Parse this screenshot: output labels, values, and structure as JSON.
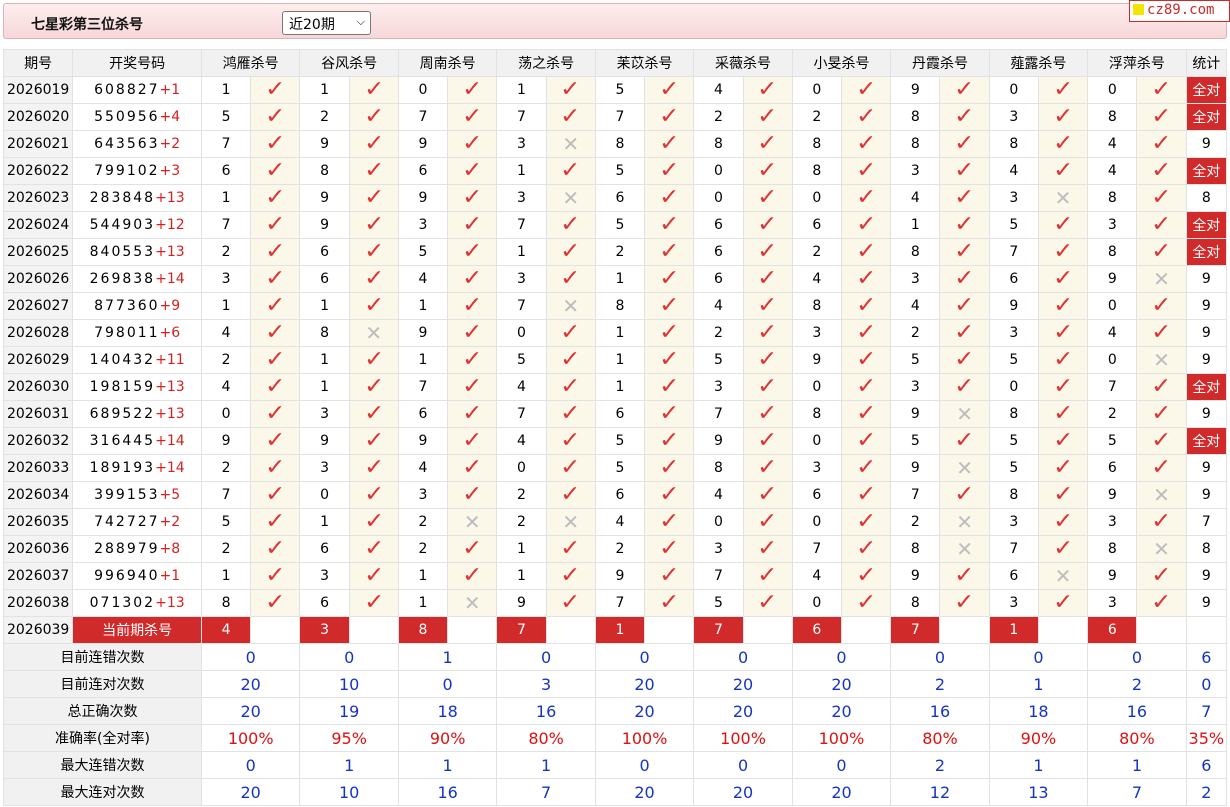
{
  "header": {
    "title": "七星彩第三位杀号",
    "period_select": "近20期",
    "site_badge": "cz89.com"
  },
  "table": {
    "columns": [
      "期号",
      "开奖号码",
      "鸿雁杀号",
      "谷风杀号",
      "周南杀号",
      "荡之杀号",
      "苿苡杀号",
      "采薇杀号",
      "小旻杀号",
      "丹霞杀号",
      "薤露杀号",
      "浮萍杀号",
      "统计"
    ],
    "rows": [
      {
        "issue": "2026019",
        "nums": "608827",
        "plus": "+1",
        "k": [
          "1",
          "1",
          "0",
          "1",
          "5",
          "4",
          "0",
          "9",
          "0",
          "0"
        ],
        "ok": [
          1,
          1,
          1,
          1,
          1,
          1,
          1,
          1,
          1,
          1
        ],
        "stat": "全对"
      },
      {
        "issue": "2026020",
        "nums": "550956",
        "plus": "+4",
        "k": [
          "5",
          "2",
          "7",
          "7",
          "7",
          "2",
          "2",
          "8",
          "3",
          "8"
        ],
        "ok": [
          1,
          1,
          1,
          1,
          1,
          1,
          1,
          1,
          1,
          1
        ],
        "stat": "全对"
      },
      {
        "issue": "2026021",
        "nums": "643563",
        "plus": "+2",
        "k": [
          "7",
          "9",
          "9",
          "3",
          "8",
          "8",
          "8",
          "8",
          "8",
          "4"
        ],
        "ok": [
          1,
          1,
          1,
          0,
          1,
          1,
          1,
          1,
          1,
          1
        ],
        "stat": "9"
      },
      {
        "issue": "2026022",
        "nums": "799102",
        "plus": "+3",
        "k": [
          "6",
          "8",
          "6",
          "1",
          "5",
          "0",
          "8",
          "3",
          "4",
          "4"
        ],
        "ok": [
          1,
          1,
          1,
          1,
          1,
          1,
          1,
          1,
          1,
          1
        ],
        "stat": "全对"
      },
      {
        "issue": "2026023",
        "nums": "283848",
        "plus": "+13",
        "k": [
          "1",
          "9",
          "9",
          "3",
          "6",
          "0",
          "0",
          "4",
          "3",
          "8"
        ],
        "ok": [
          1,
          1,
          1,
          0,
          1,
          1,
          1,
          1,
          0,
          1
        ],
        "stat": "8"
      },
      {
        "issue": "2026024",
        "nums": "544903",
        "plus": "+12",
        "k": [
          "7",
          "9",
          "3",
          "7",
          "5",
          "6",
          "6",
          "1",
          "5",
          "3"
        ],
        "ok": [
          1,
          1,
          1,
          1,
          1,
          1,
          1,
          1,
          1,
          1
        ],
        "stat": "全对"
      },
      {
        "issue": "2026025",
        "nums": "840553",
        "plus": "+13",
        "k": [
          "2",
          "6",
          "5",
          "1",
          "2",
          "6",
          "2",
          "8",
          "7",
          "8"
        ],
        "ok": [
          1,
          1,
          1,
          1,
          1,
          1,
          1,
          1,
          1,
          1
        ],
        "stat": "全对"
      },
      {
        "issue": "2026026",
        "nums": "269838",
        "plus": "+14",
        "k": [
          "3",
          "6",
          "4",
          "3",
          "1",
          "6",
          "4",
          "3",
          "6",
          "9"
        ],
        "ok": [
          1,
          1,
          1,
          1,
          1,
          1,
          1,
          1,
          1,
          0
        ],
        "stat": "9"
      },
      {
        "issue": "2026027",
        "nums": "877360",
        "plus": "+9",
        "k": [
          "1",
          "1",
          "1",
          "7",
          "8",
          "4",
          "8",
          "4",
          "9",
          "0"
        ],
        "ok": [
          1,
          1,
          1,
          0,
          1,
          1,
          1,
          1,
          1,
          1
        ],
        "stat": "9"
      },
      {
        "issue": "2026028",
        "nums": "798011",
        "plus": "+6",
        "k": [
          "4",
          "8",
          "9",
          "0",
          "1",
          "2",
          "3",
          "2",
          "3",
          "4"
        ],
        "ok": [
          1,
          0,
          1,
          1,
          1,
          1,
          1,
          1,
          1,
          1
        ],
        "stat": "9"
      },
      {
        "issue": "2026029",
        "nums": "140432",
        "plus": "+11",
        "k": [
          "2",
          "1",
          "1",
          "5",
          "1",
          "5",
          "9",
          "5",
          "5",
          "0"
        ],
        "ok": [
          1,
          1,
          1,
          1,
          1,
          1,
          1,
          1,
          1,
          0
        ],
        "stat": "9"
      },
      {
        "issue": "2026030",
        "nums": "198159",
        "plus": "+13",
        "k": [
          "4",
          "1",
          "7",
          "4",
          "1",
          "3",
          "0",
          "3",
          "0",
          "7"
        ],
        "ok": [
          1,
          1,
          1,
          1,
          1,
          1,
          1,
          1,
          1,
          1
        ],
        "stat": "全对"
      },
      {
        "issue": "2026031",
        "nums": "689522",
        "plus": "+13",
        "k": [
          "0",
          "3",
          "6",
          "7",
          "6",
          "7",
          "8",
          "9",
          "8",
          "2"
        ],
        "ok": [
          1,
          1,
          1,
          1,
          1,
          1,
          1,
          0,
          1,
          1
        ],
        "stat": "9"
      },
      {
        "issue": "2026032",
        "nums": "316445",
        "plus": "+14",
        "k": [
          "9",
          "9",
          "9",
          "4",
          "5",
          "9",
          "0",
          "5",
          "5",
          "5"
        ],
        "ok": [
          1,
          1,
          1,
          1,
          1,
          1,
          1,
          1,
          1,
          1
        ],
        "stat": "全对"
      },
      {
        "issue": "2026033",
        "nums": "189193",
        "plus": "+14",
        "k": [
          "2",
          "3",
          "4",
          "0",
          "5",
          "8",
          "3",
          "9",
          "5",
          "6"
        ],
        "ok": [
          1,
          1,
          1,
          1,
          1,
          1,
          1,
          0,
          1,
          1
        ],
        "stat": "9"
      },
      {
        "issue": "2026034",
        "nums": "399153",
        "plus": "+5",
        "k": [
          "7",
          "0",
          "3",
          "2",
          "6",
          "4",
          "6",
          "7",
          "8",
          "9"
        ],
        "ok": [
          1,
          1,
          1,
          1,
          1,
          1,
          1,
          1,
          1,
          0
        ],
        "stat": "9"
      },
      {
        "issue": "2026035",
        "nums": "742727",
        "plus": "+2",
        "k": [
          "5",
          "1",
          "2",
          "2",
          "4",
          "0",
          "0",
          "2",
          "3",
          "3"
        ],
        "ok": [
          1,
          1,
          0,
          0,
          1,
          1,
          1,
          0,
          1,
          1
        ],
        "stat": "7"
      },
      {
        "issue": "2026036",
        "nums": "288979",
        "plus": "+8",
        "k": [
          "2",
          "6",
          "2",
          "1",
          "2",
          "3",
          "7",
          "8",
          "7",
          "8"
        ],
        "ok": [
          1,
          1,
          1,
          1,
          1,
          1,
          1,
          0,
          1,
          0
        ],
        "stat": "8"
      },
      {
        "issue": "2026037",
        "nums": "996940",
        "plus": "+1",
        "k": [
          "1",
          "3",
          "1",
          "1",
          "9",
          "7",
          "4",
          "9",
          "6",
          "9"
        ],
        "ok": [
          1,
          1,
          1,
          1,
          1,
          1,
          1,
          1,
          0,
          1
        ],
        "stat": "9"
      },
      {
        "issue": "2026038",
        "nums": "071302",
        "plus": "+13",
        "k": [
          "8",
          "6",
          "1",
          "9",
          "7",
          "5",
          "0",
          "8",
          "3",
          "3"
        ],
        "ok": [
          1,
          1,
          0,
          1,
          1,
          1,
          1,
          1,
          1,
          1
        ],
        "stat": "9"
      }
    ],
    "current": {
      "issue": "2026039",
      "label": "当前期杀号",
      "k": [
        "4",
        "3",
        "8",
        "7",
        "1",
        "7",
        "6",
        "7",
        "1",
        "6"
      ]
    }
  },
  "summary": [
    {
      "label": "目前连错次数",
      "values": [
        "0",
        "0",
        "1",
        "0",
        "0",
        "0",
        "0",
        "0",
        "0",
        "0"
      ],
      "total": "6"
    },
    {
      "label": "目前连对次数",
      "values": [
        "20",
        "10",
        "0",
        "3",
        "20",
        "20",
        "20",
        "2",
        "1",
        "2"
      ],
      "total": "0"
    },
    {
      "label": "总正确次数",
      "values": [
        "20",
        "19",
        "18",
        "16",
        "20",
        "20",
        "20",
        "16",
        "18",
        "16"
      ],
      "total": "7"
    },
    {
      "label": "准确率(全对率)",
      "values": [
        "100%",
        "95%",
        "90%",
        "80%",
        "100%",
        "100%",
        "100%",
        "80%",
        "90%",
        "80%"
      ],
      "total": "35%",
      "is_pct": true
    },
    {
      "label": "最大连错次数",
      "values": [
        "0",
        "1",
        "1",
        "1",
        "0",
        "0",
        "0",
        "2",
        "1",
        "1"
      ],
      "total": "6"
    },
    {
      "label": "最大连对次数",
      "values": [
        "20",
        "10",
        "16",
        "7",
        "20",
        "20",
        "20",
        "12",
        "13",
        "7"
      ],
      "total": "2"
    }
  ]
}
